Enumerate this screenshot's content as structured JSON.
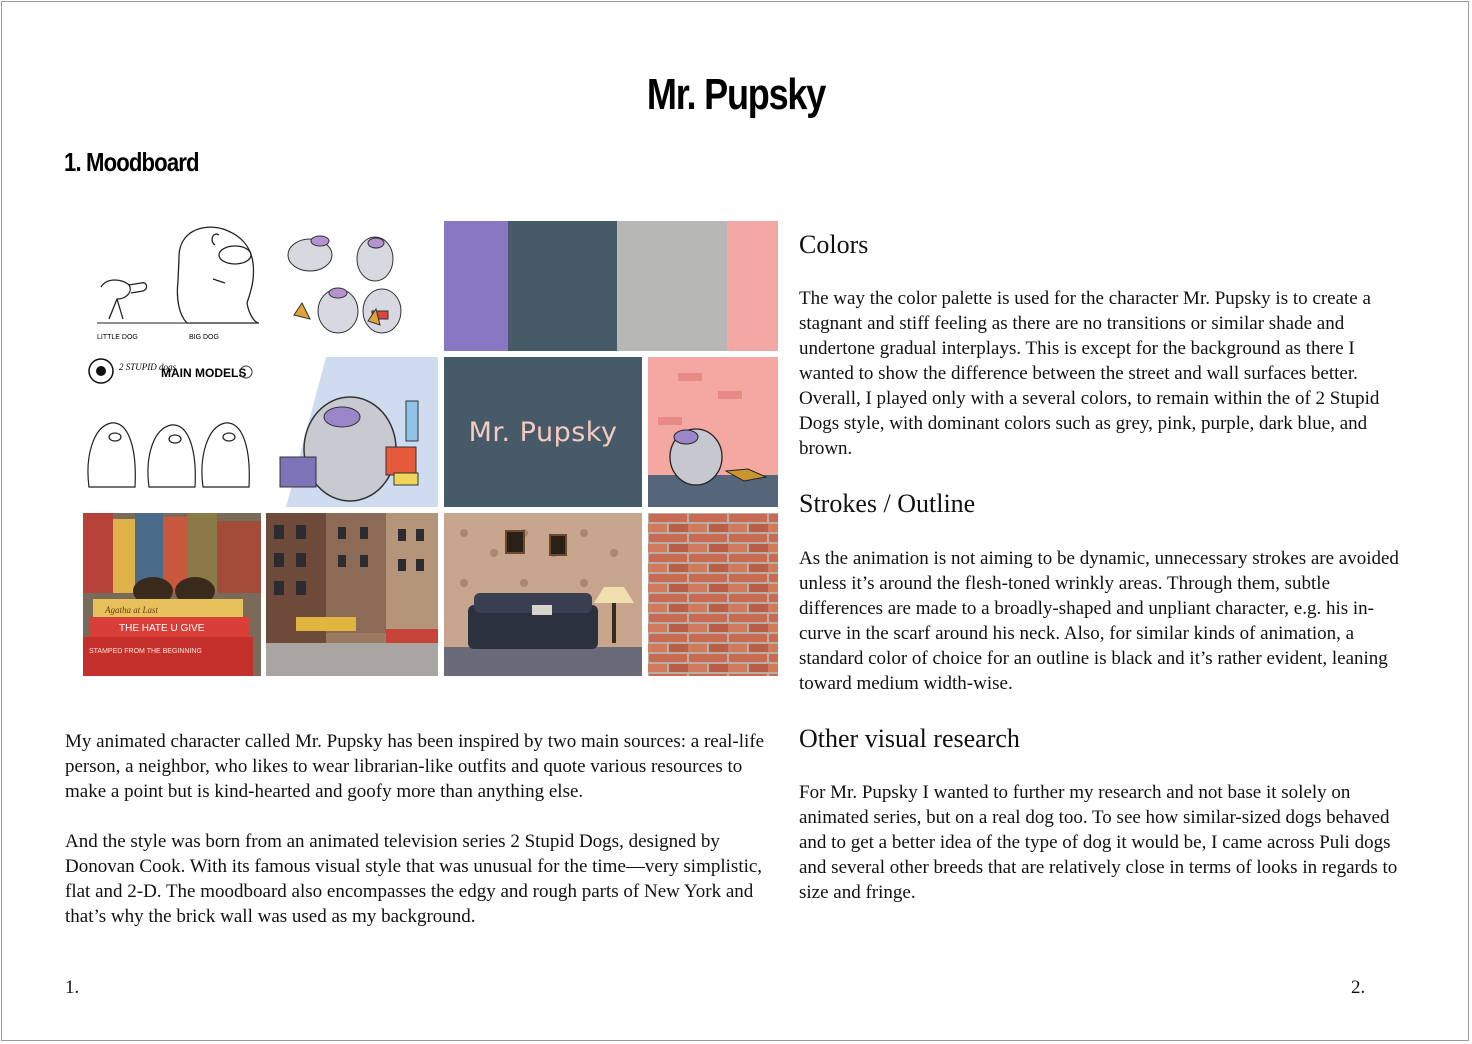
{
  "document": {
    "title": "Mr. Pupsky",
    "section_title": "1. Moodboard",
    "page_left": "1.",
    "page_right": "2."
  },
  "moodboard": {
    "sketch1_labels": [
      "LITTLE DOG",
      "BIG DOG"
    ],
    "model_sheet_text": "MAIN MODELS",
    "model_sheet_logo": "2 STUPID dogs",
    "palette": [
      "#8878c4",
      "#475a67",
      "#b7b8b5",
      "#f2a9a6"
    ],
    "name_card": "Mr. Pupsky",
    "book_titles": [
      "Agatha at Last",
      "THE HATE U GIVE",
      "STAMPED FROM THE BEGINNING"
    ]
  },
  "left_text": {
    "p1": "My animated character called Mr. Pupsky has been inspired by two main sources: a real-life person, a neighbor, who likes to wear librarian-like outfits and quote various resources to make a point but is kind-hearted and goofy more than anything else.",
    "p2": "And the style was born from an animated television series 2 Stupid Dogs, designed by Donovan Cook. With its famous visual style that was unusual for the time—very simplistic, flat and 2-D. The moodboard also encompasses the edgy and rough parts of New York and that’s why the brick wall was used as my background."
  },
  "right_text": {
    "colors_heading": "Colors",
    "colors_body": "The way the color palette is used for the character Mr. Pupsky is to create a stagnant and stiff feeling as there are no transitions or similar shade and undertone gradual interplays. This is except for the background as there I wanted to show the difference between the street and wall surfaces better.  Overall, I played only with a several colors, to remain within the of 2 Stupid Dogs style, with dominant colors such as grey, pink, purple, dark blue, and brown.",
    "strokes_heading": "Strokes / Outline",
    "strokes_body": "As the animation is not aiming to be dynamic, unnecessary strokes are avoided unless it’s around the flesh-toned wrinkly areas. Through them, subtle differences are made to a broadly-shaped and unpliant character, e.g. his in-curve in the scarf around his neck. Also, for similar kinds of animation, a standard color of choice for an outline is black and it’s rather evident, leaning toward medium width-wise.",
    "research_heading": "Other visual research",
    "research_body": "For Mr. Pupsky I wanted to further my research and not base it solely on animated series, but on a real dog too. To see how similar-sized dogs behaved and to get a better idea of the type of dog it would be, I came across Puli dogs and several other breeds that are relatively close in terms of looks in regards to size and fringe."
  }
}
